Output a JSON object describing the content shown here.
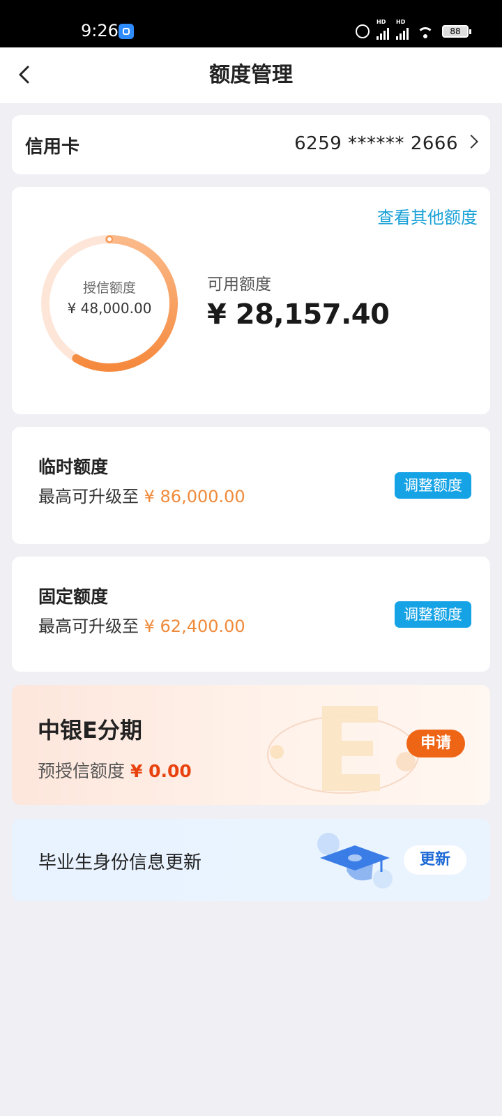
{
  "status_bar": {
    "time": "9:26",
    "battery": "88"
  },
  "header": {
    "title": "额度管理"
  },
  "card_selector": {
    "type_label": "信用卡",
    "card_number": "6259 ****** 2666"
  },
  "credit_overview": {
    "other_limits_link": "查看其他额度",
    "credit_limit_label": "授信额度",
    "credit_limit_value": "¥ 48,000.00",
    "available_label": "可用额度",
    "available_value": "¥ 28,157.40",
    "available_ratio": 0.5866,
    "ring_color": "#f7924a",
    "ring_track_color": "#fde6d8"
  },
  "temporary_limit": {
    "title": "临时额度",
    "subtitle": "最高可升级至",
    "amount": "¥ 86,000.00",
    "button": "调整额度"
  },
  "fixed_limit": {
    "title": "固定额度",
    "subtitle": "最高可升级至",
    "amount": "¥ 62,400.00",
    "button": "调整额度"
  },
  "e_installment": {
    "title": "中银E分期",
    "subtitle": "预授信额度",
    "amount": "¥ 0.00",
    "button": "申请"
  },
  "graduate_update": {
    "label": "毕业生身份信息更新",
    "button": "更新"
  },
  "colors": {
    "accent_blue": "#16a3e6",
    "link_blue": "#19a1d7",
    "amount_orange": "#f08a3b",
    "apply_orange": "#ef6516"
  }
}
